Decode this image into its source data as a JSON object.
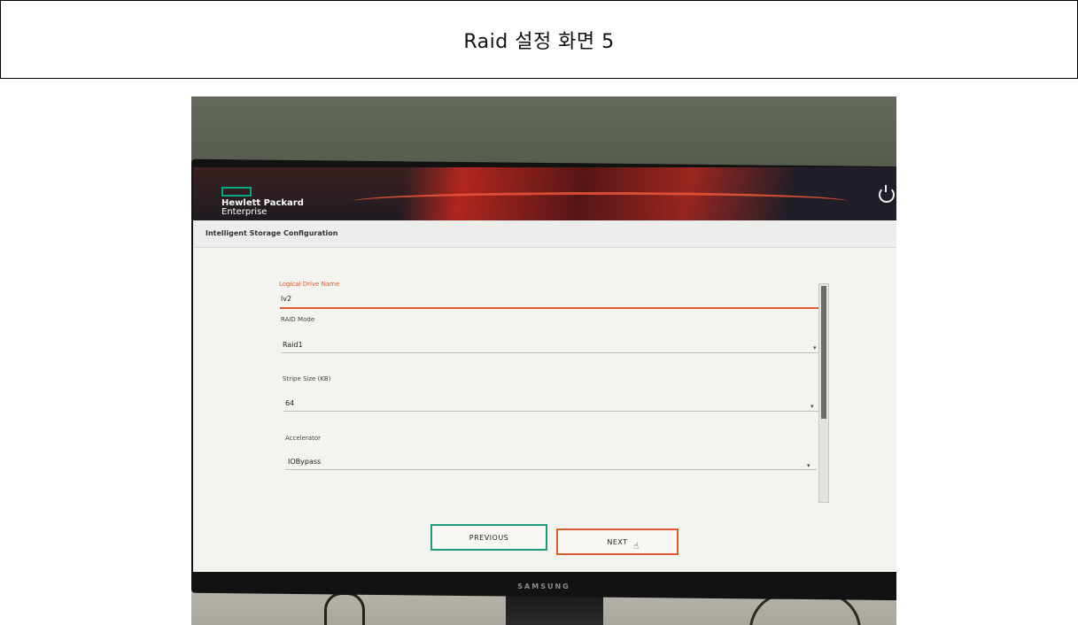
{
  "caption": {
    "title": "Raid 설정 화면 5"
  },
  "monitor": {
    "brand": "SAMSUNG"
  },
  "app": {
    "vendor_line1": "Hewlett Packard",
    "vendor_line2": "Enterprise",
    "section_title": "Intelligent Storage Configuration"
  },
  "form": {
    "logical_drive": {
      "label": "Logical Drive Name",
      "value": "lv2"
    },
    "raid_mode": {
      "label": "RAID Mode",
      "value": "Raid1"
    },
    "stripe_size": {
      "label": "Stripe Size (KB)",
      "value": "64"
    },
    "accelerator": {
      "label": "Accelerator",
      "value": "IOBypass"
    }
  },
  "buttons": {
    "previous": "PREVIOUS",
    "next": "NEXT"
  },
  "colors": {
    "accent": "#e05a2c",
    "hpe_green": "#01a982",
    "teal": "#1d9a80"
  }
}
